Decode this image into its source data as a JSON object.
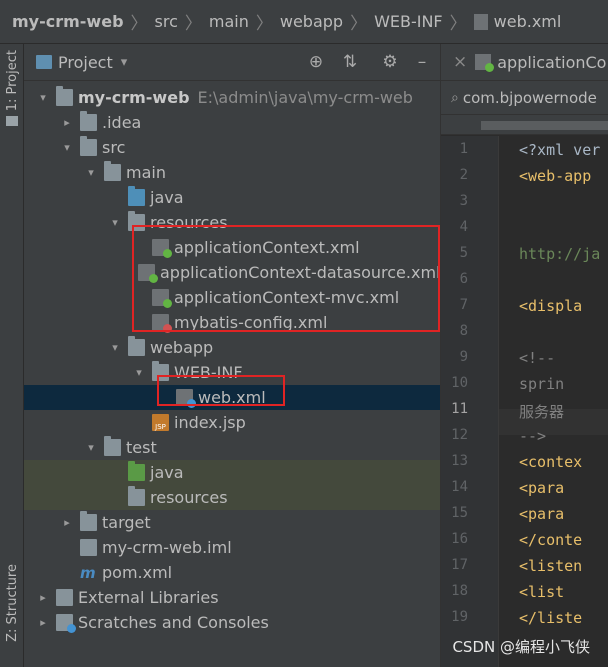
{
  "breadcrumb": [
    "my-crm-web",
    "src",
    "main",
    "webapp",
    "WEB-INF",
    "web.xml"
  ],
  "left_strip": {
    "project_tab": "1: Project",
    "structure_tab": "Z: Structure"
  },
  "panel": {
    "title": "Project",
    "dropdown": "▾",
    "tools": {
      "locate": "⊕",
      "collapse": "⇅",
      "settings": "⚙",
      "hide": "–"
    }
  },
  "tree": [
    {
      "label": "my-crm-web",
      "path": "E:\\admin\\java\\my-crm-web",
      "icon": "module-folder-icon",
      "arrow": "▾"
    },
    {
      "label": ".idea",
      "icon": "folder-icon",
      "arrow": "▸"
    },
    {
      "label": "src",
      "icon": "folder-icon",
      "arrow": "▾"
    },
    {
      "label": "main",
      "icon": "folder-icon",
      "arrow": "▾"
    },
    {
      "label": "java",
      "icon": "source-folder-icon",
      "arrow": ""
    },
    {
      "label": "resources",
      "icon": "resources-folder-icon",
      "arrow": "▾"
    },
    {
      "label": "applicationContext.xml",
      "icon": "spring-xml-icon",
      "arrow": ""
    },
    {
      "label": "applicationContext-datasource.xml",
      "icon": "spring-xml-icon",
      "arrow": ""
    },
    {
      "label": "applicationContext-mvc.xml",
      "icon": "spring-xml-icon",
      "arrow": ""
    },
    {
      "label": "mybatis-config.xml",
      "icon": "xml-icon",
      "arrow": ""
    },
    {
      "label": "webapp",
      "icon": "web-folder-icon",
      "arrow": "▾"
    },
    {
      "label": "WEB-INF",
      "icon": "folder-icon",
      "arrow": "▾"
    },
    {
      "label": "web.xml",
      "icon": "web-xml-icon",
      "arrow": ""
    },
    {
      "label": "index.jsp",
      "icon": "jsp-icon",
      "arrow": ""
    },
    {
      "label": "test",
      "icon": "folder-icon",
      "arrow": "▾"
    },
    {
      "label": "java",
      "icon": "test-folder-icon",
      "arrow": ""
    },
    {
      "label": "resources",
      "icon": "test-resources-folder-icon",
      "arrow": ""
    },
    {
      "label": "target",
      "icon": "excluded-folder-icon",
      "arrow": "▸"
    },
    {
      "label": "my-crm-web.iml",
      "icon": "iml-icon",
      "arrow": ""
    },
    {
      "label": "pom.xml",
      "icon": "maven-icon",
      "arrow": ""
    },
    {
      "label": "External Libraries",
      "icon": "libraries-icon",
      "arrow": "▸"
    },
    {
      "label": "Scratches and Consoles",
      "icon": "scratches-icon",
      "arrow": "▸"
    }
  ],
  "editor": {
    "tab_close": "×",
    "tab_label": "applicationCo",
    "search_text": "com.bjpowernode",
    "line_numbers": [
      "1",
      "2",
      "3",
      "4",
      "5",
      "6",
      "7",
      "8",
      "9",
      "10",
      "11",
      "12",
      "13",
      "14",
      "15",
      "16",
      "17",
      "18",
      "19"
    ],
    "lines": [
      {
        "text": "<?xml ver",
        "cls": "c-plain"
      },
      {
        "text": "<web-app ",
        "cls": "c-tag"
      },
      {
        "text": "",
        "cls": "c-plain"
      },
      {
        "text": "",
        "cls": "c-plain"
      },
      {
        "text": "http://ja",
        "cls": "c-url"
      },
      {
        "text": "",
        "cls": "c-plain"
      },
      {
        "text": "  <displa",
        "cls": "c-tag"
      },
      {
        "text": "",
        "cls": "c-plain"
      },
      {
        "text": "  <!--",
        "cls": "c-comment"
      },
      {
        "text": "    sprin",
        "cls": "c-comment"
      },
      {
        "text": "    服务器",
        "cls": "c-comment"
      },
      {
        "text": "  -->",
        "cls": "c-comment"
      },
      {
        "text": "  <contex",
        "cls": "c-tag"
      },
      {
        "text": "    <para",
        "cls": "c-tag"
      },
      {
        "text": "    <para",
        "cls": "c-tag"
      },
      {
        "text": "  </conte",
        "cls": "c-tag"
      },
      {
        "text": "  <listen",
        "cls": "c-tag"
      },
      {
        "text": "    <list",
        "cls": "c-tag"
      },
      {
        "text": "  </liste",
        "cls": "c-tag"
      }
    ]
  },
  "watermark": "CSDN @编程小飞侠",
  "colors": {
    "highlight_box": "#e02424",
    "selection": "#0d293e",
    "test_folder_bg": "#44493c"
  }
}
